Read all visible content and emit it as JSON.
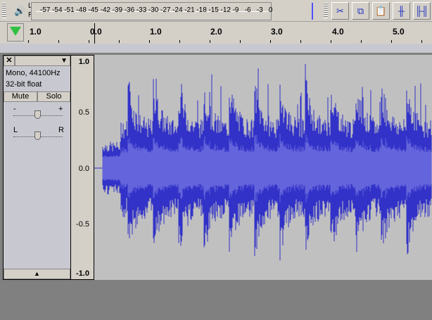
{
  "meter": {
    "left_label": "L",
    "right_label": "R",
    "ticks": [
      "-57",
      "-54",
      "-51",
      "-48",
      "-45",
      "-42",
      "-39",
      "-36",
      "-33",
      "-30",
      "-27",
      "-24",
      "-21",
      "-18",
      "-15",
      "-12",
      "-9",
      "-6",
      "-3",
      "0"
    ]
  },
  "edit_tools": [
    "cut-icon",
    "copy-icon",
    "paste-icon",
    "trim-icon",
    "silence-icon"
  ],
  "ruler": {
    "labels": [
      "1.0",
      "0.0",
      "1.0",
      "2.0",
      "3.0",
      "4.0",
      "5.0"
    ]
  },
  "track": {
    "format": "Mono, 44100Hz",
    "bit_depth": "32-bit float",
    "mute": "Mute",
    "solo": "Solo",
    "gain_min": "-",
    "gain_max": "+",
    "pan_left": "L",
    "pan_right": "R",
    "gain_level": 0.5,
    "pan_level": 0.5
  },
  "vruler": [
    "1.0",
    "0.5",
    "0.0",
    "-0.5",
    "-1.0"
  ],
  "colors": {
    "waveform": "#3232c8",
    "waveform_rms": "#6464dc",
    "background": "#c0c0c0"
  }
}
